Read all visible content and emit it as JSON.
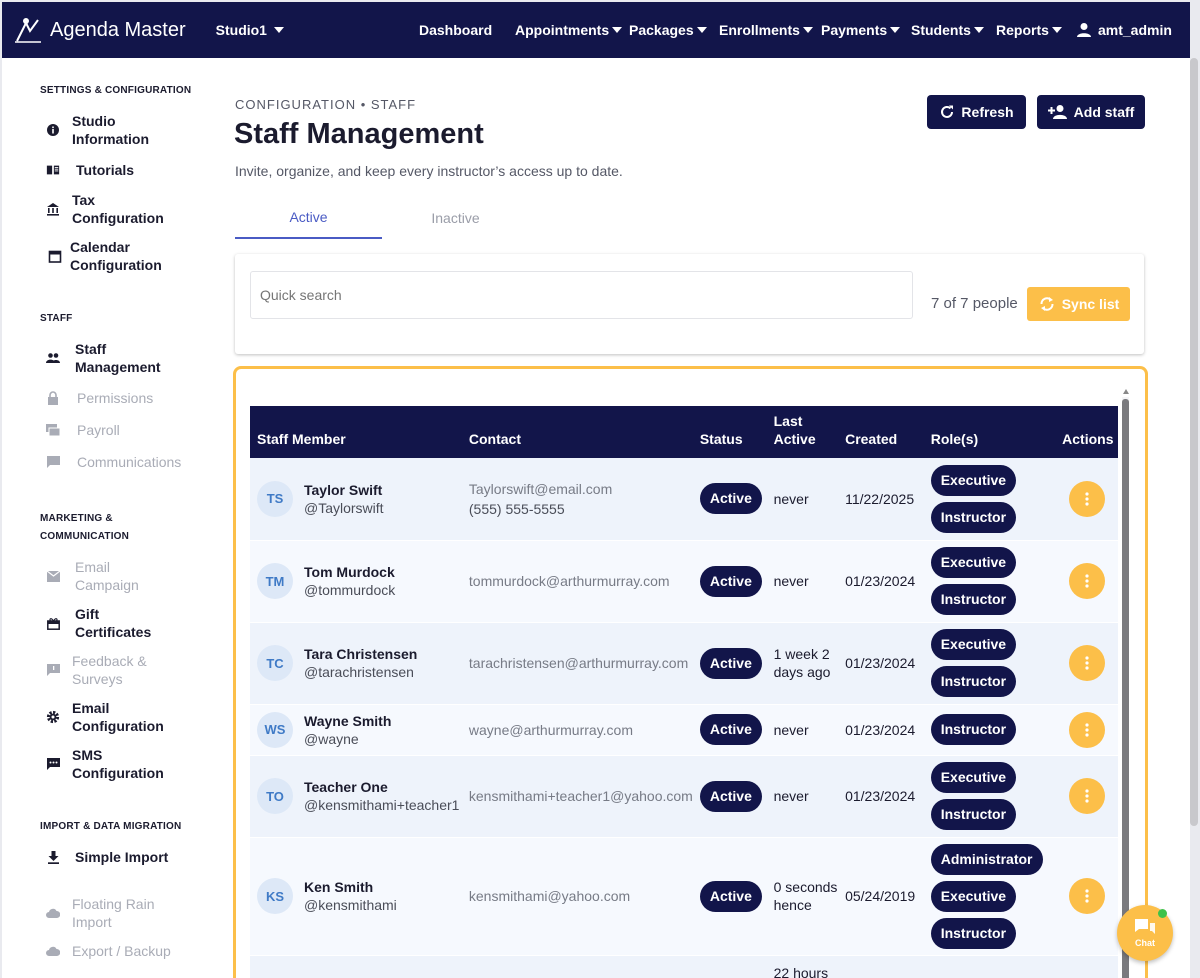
{
  "nav": {
    "brand": "Agenda Master",
    "studio": "Studio1",
    "links": [
      "Dashboard",
      "Appointments",
      "Packages",
      "Enrollments",
      "Payments",
      "Students",
      "Reports"
    ],
    "user": "amt_admin"
  },
  "sidebar": {
    "sections": [
      {
        "heading": "SETTINGS & CONFIGURATION",
        "items": [
          {
            "label": "Studio Information",
            "icon": "info-icon",
            "enabled": true
          },
          {
            "label": "Tutorials",
            "icon": "book-icon",
            "enabled": true
          },
          {
            "label": "Tax Configuration",
            "icon": "bank-icon",
            "enabled": true
          },
          {
            "label": "Calendar Configuration",
            "icon": "calendar-icon",
            "enabled": true
          }
        ]
      },
      {
        "heading": "STAFF",
        "items": [
          {
            "label": "Staff Management",
            "icon": "people-icon",
            "enabled": true
          },
          {
            "label": "Permissions",
            "icon": "lock-icon",
            "enabled": false
          },
          {
            "label": "Payroll",
            "icon": "payroll-icon",
            "enabled": false
          },
          {
            "label": "Communications",
            "icon": "message-icon",
            "enabled": false
          }
        ]
      },
      {
        "heading": "MARKETING & COMMUNICATION",
        "items": [
          {
            "label": "Email Campaign",
            "icon": "email-icon",
            "enabled": false
          },
          {
            "label": "Gift Certificates",
            "icon": "gift-icon",
            "enabled": true
          },
          {
            "label": "Feedback & Surveys",
            "icon": "feedback-icon",
            "enabled": false
          },
          {
            "label": "Email Configuration",
            "icon": "gear-icon",
            "enabled": true
          },
          {
            "label": "SMS Configuration",
            "icon": "sms-icon",
            "enabled": true
          }
        ]
      },
      {
        "heading": "IMPORT & DATA MIGRATION",
        "items": [
          {
            "label": "Simple Import",
            "icon": "download-icon",
            "enabled": true
          },
          {
            "label": "Floating Rain Import",
            "icon": "cloud-icon",
            "enabled": false
          },
          {
            "label": "Export / Backup",
            "icon": "cloud-icon",
            "enabled": false
          }
        ]
      }
    ]
  },
  "header": {
    "eyebrow": "CONFIGURATION • STAFF",
    "title": "Staff Management",
    "subtitle": "Invite, organize, and keep every instructor’s access up to date.",
    "refresh_label": "Refresh",
    "add_label": "Add staff"
  },
  "tabs": [
    {
      "label": "Active",
      "active": true
    },
    {
      "label": "Inactive",
      "active": false
    }
  ],
  "search": {
    "placeholder": "Quick search",
    "count": "7 of 7 people",
    "sync_label": "Sync list"
  },
  "table": {
    "headers": [
      "Staff Member",
      "Contact",
      "Status",
      "Last Active",
      "Created",
      "Role(s)",
      "Actions"
    ],
    "rows": [
      {
        "initials": "TS",
        "name": "Taylor Swift",
        "handle": "@Taylorswift",
        "email": "Taylorswift@email.com",
        "phone": "(555) 555-5555",
        "status": "Active",
        "last": "never",
        "created": "11/22/2025",
        "roles": [
          "Executive",
          "Instructor"
        ]
      },
      {
        "initials": "TM",
        "name": "Tom Murdock",
        "handle": "@tommurdock",
        "email": "tommurdock@arthurmurray.com",
        "phone": "",
        "status": "Active",
        "last": "never",
        "created": "01/23/2024",
        "roles": [
          "Executive",
          "Instructor"
        ]
      },
      {
        "initials": "TC",
        "name": "Tara Christensen",
        "handle": "@tarachristensen",
        "email": "tarachristensen@arthurmurray.com",
        "phone": "",
        "status": "Active",
        "last": "1 week 2 days ago",
        "created": "01/23/2024",
        "roles": [
          "Executive",
          "Instructor"
        ]
      },
      {
        "initials": "WS",
        "name": "Wayne Smith",
        "handle": "@wayne",
        "email": "wayne@arthurmurray.com",
        "phone": "",
        "status": "Active",
        "last": "never",
        "created": "01/23/2024",
        "roles": [
          "Instructor"
        ]
      },
      {
        "initials": "TO",
        "name": "Teacher One",
        "handle": "@kensmithami+teacher1",
        "email": "kensmithami+teacher1@yahoo.com",
        "phone": "",
        "status": "Active",
        "last": "never",
        "created": "01/23/2024",
        "roles": [
          "Executive",
          "Instructor"
        ]
      },
      {
        "initials": "KS",
        "name": "Ken Smith",
        "handle": "@kensmithami",
        "email": "kensmithami@yahoo.com",
        "phone": "",
        "status": "Active",
        "last": "0 seconds hence",
        "created": "05/24/2019",
        "roles": [
          "Administrator",
          "Executive",
          "Instructor"
        ]
      },
      {
        "initials": "",
        "name": "",
        "handle": "",
        "email": "",
        "phone": "",
        "status": "",
        "last": "22 hours",
        "created": "",
        "roles": []
      }
    ]
  },
  "chat": {
    "label": "Chat"
  },
  "colors": {
    "navy": "#12154a",
    "accent": "#fcbf49",
    "tab": "#4a5bc4"
  }
}
